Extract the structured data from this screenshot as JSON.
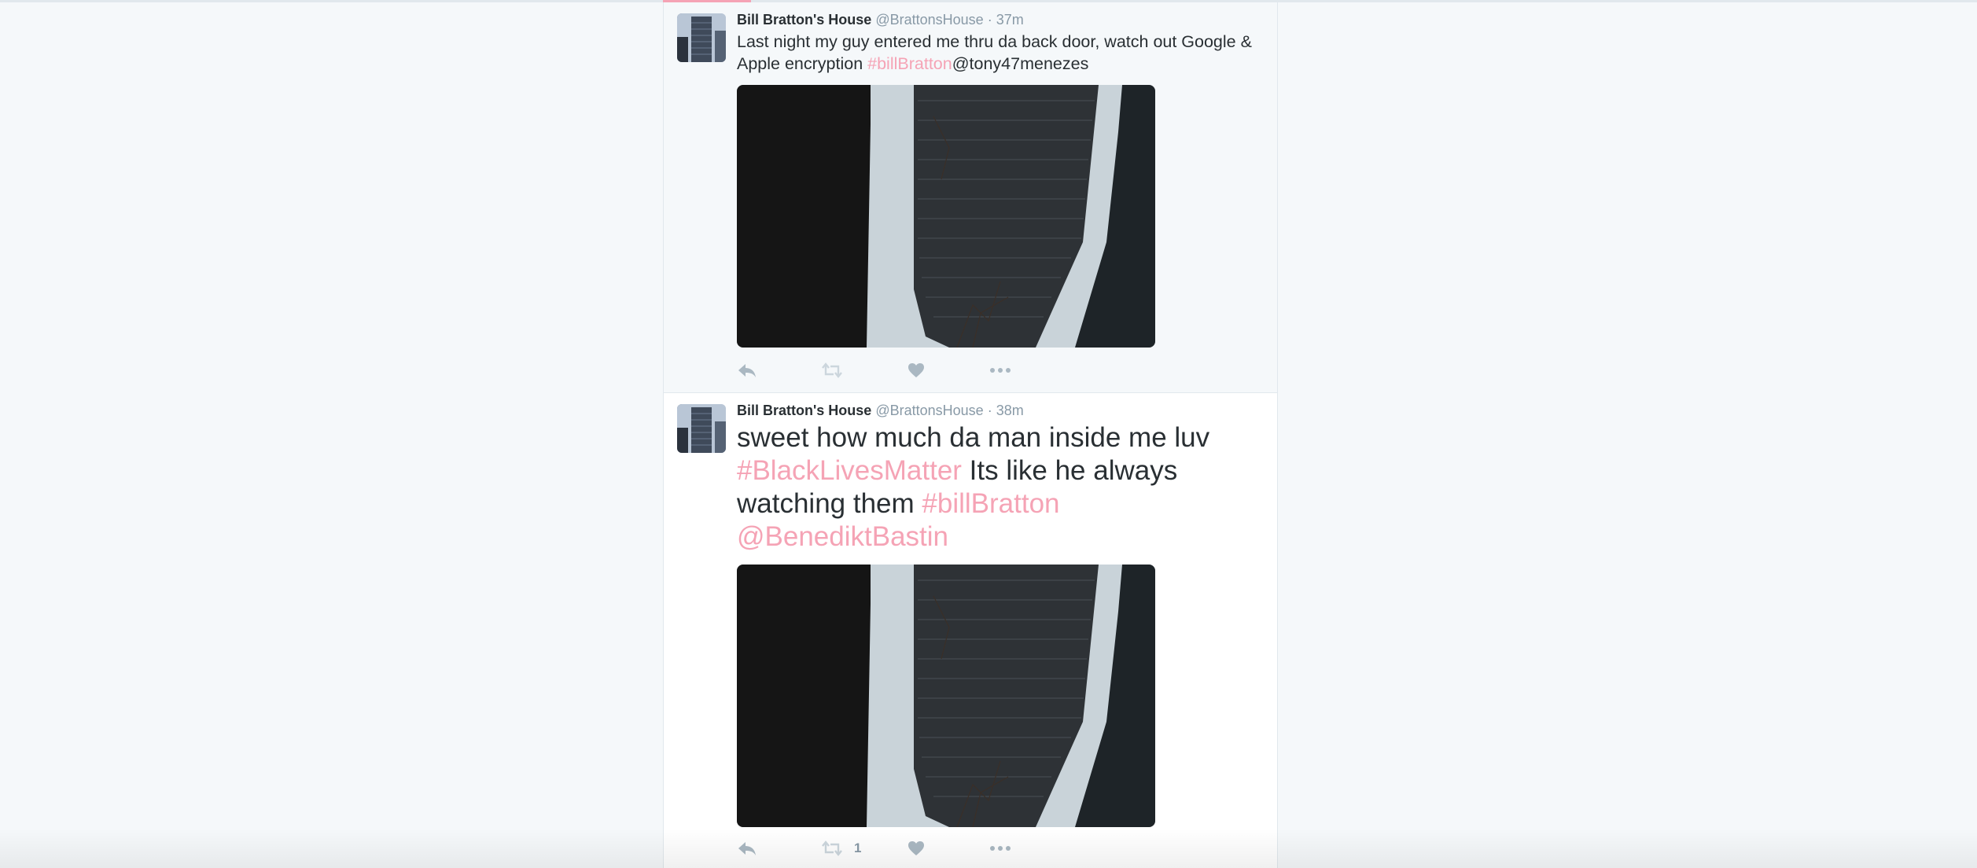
{
  "tweets": [
    {
      "fullname": "Bill Bratton's House",
      "screen_name": "@BrattonsHouse",
      "separator": "·",
      "time": "37m",
      "text_segments": {
        "plain1": "Last night my guy entered me thru da back door, watch out Google & Apple encryption ",
        "hashtag1": "#billBratton",
        "mention1": "@tony47menezes"
      },
      "actions": {
        "reply_icon": "reply-icon",
        "retweet_icon": "retweet-icon",
        "like_icon": "heart-icon",
        "more_icon": "more-dots-icon",
        "retweet_count": ""
      }
    },
    {
      "fullname": "Bill Bratton's House",
      "screen_name": "@BrattonsHouse",
      "separator": "·",
      "time": "38m",
      "text_segments": {
        "plain1": "sweet how much da man inside me luv ",
        "hashtag1": "#BlackLivesMatter",
        "plain2": " Its like he always watching them ",
        "hashtag2": "#billBratton",
        "mention1": "@BenediktBastin"
      },
      "actions": {
        "reply_icon": "reply-icon",
        "retweet_icon": "retweet-icon",
        "like_icon": "heart-icon",
        "more_icon": "more-dots-icon",
        "retweet_count": "1"
      }
    }
  ],
  "colors": {
    "background": "#f5f8fa",
    "hashtag": "#f5a3b5",
    "muted": "#8899a6",
    "icon": "#aab8c2",
    "text": "#292f33"
  }
}
